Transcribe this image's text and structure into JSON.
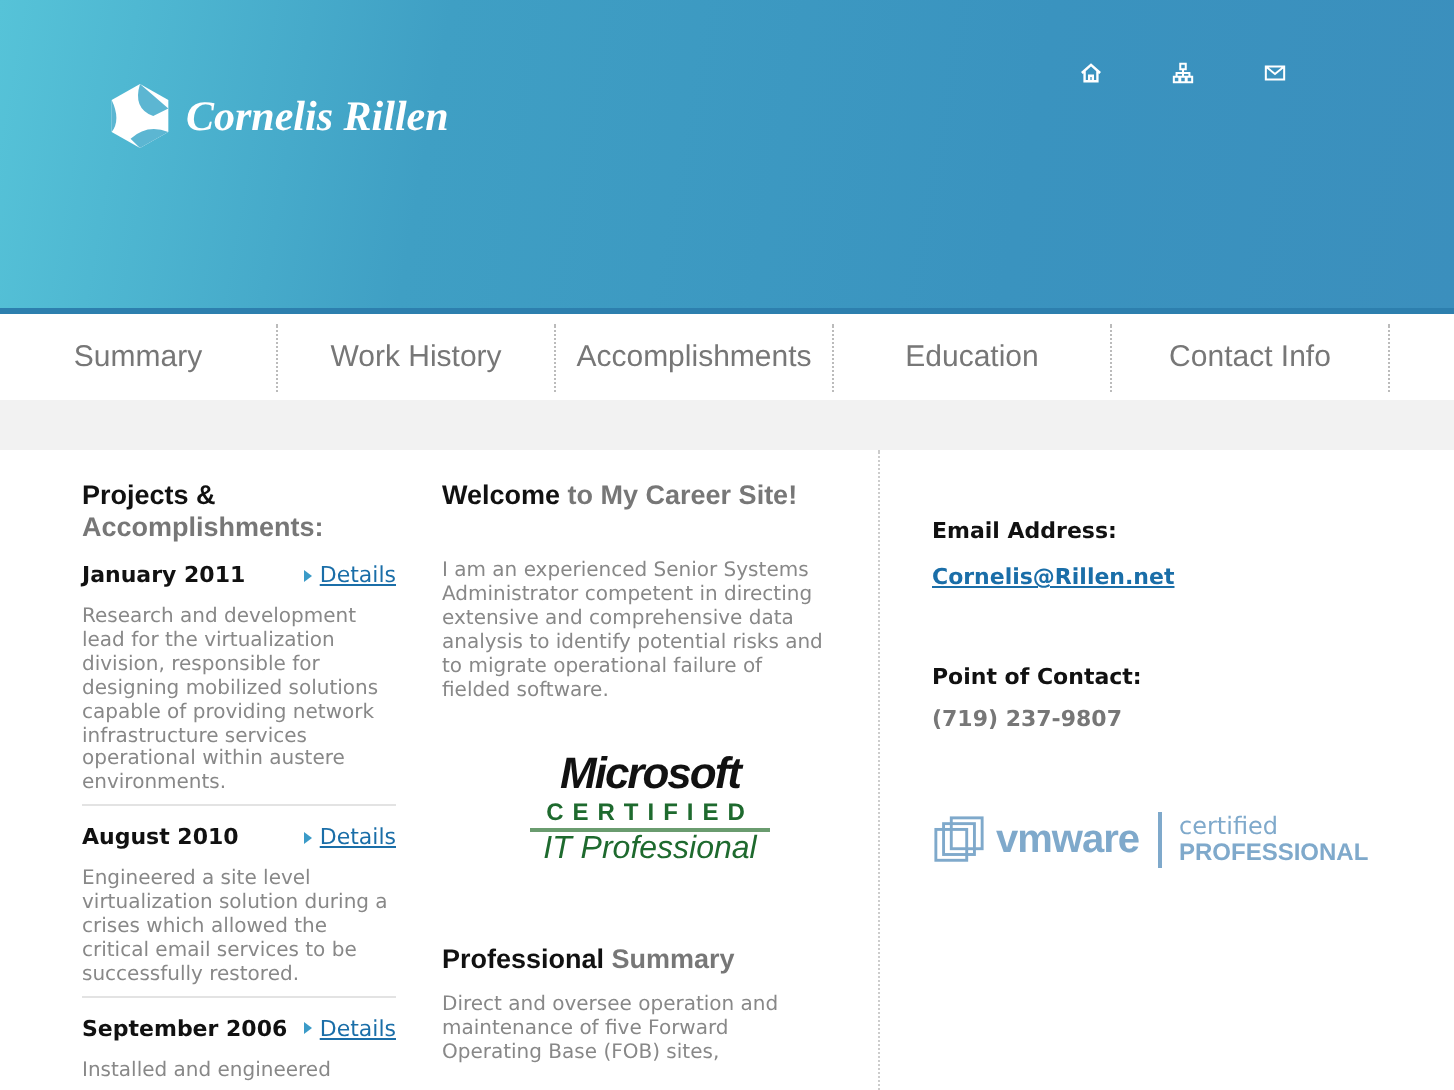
{
  "header": {
    "logo_text": "Cornelis Rillen"
  },
  "nav": [
    {
      "label": "Summary"
    },
    {
      "label": "Work History"
    },
    {
      "label": "Accomplishments"
    },
    {
      "label": "Education"
    },
    {
      "label": "Contact Info"
    }
  ],
  "projects": {
    "title_lead": "Projects &",
    "title_rest": "Accomplishments:",
    "items": [
      {
        "date": "January 2011",
        "link": "Details",
        "text": "Research and development lead for the virtualization division, responsible for designing mobilized solutions capable of providing network infrastructure services operational within austere environments."
      },
      {
        "date": "August 2010",
        "link": "Details",
        "text": "Engineered a site level virtualization solution during a crises which allowed the critical email services to be successfully restored."
      },
      {
        "date": "September 2006",
        "link": "Details",
        "text": "Installed and engineered"
      }
    ]
  },
  "welcome": {
    "title_lead": "Welcome",
    "title_rest": "to My Career Site!",
    "text": "I am an experienced Senior Systems Administrator competent in directing extensive and comprehensive data analysis to identify potential risks and to migrate operational failure of fielded software."
  },
  "ms_badge": {
    "brand": "Microsoft",
    "line1": "CERTIFIED",
    "line2": "IT Professional"
  },
  "summary": {
    "title_lead": "Professional",
    "title_rest": "Summary",
    "text": "Direct and oversee operation and maintenance of five Forward Operating Base (FOB) sites,"
  },
  "contact": {
    "email_label": "Email Address:",
    "email": "Cornelis@Rillen.net",
    "poc_label": "Point of Contact:",
    "phone": "(719) 237-9807"
  },
  "vmware_badge": {
    "brand": "vmware",
    "line1": "certified",
    "line2": "PROFESSIONAL"
  }
}
